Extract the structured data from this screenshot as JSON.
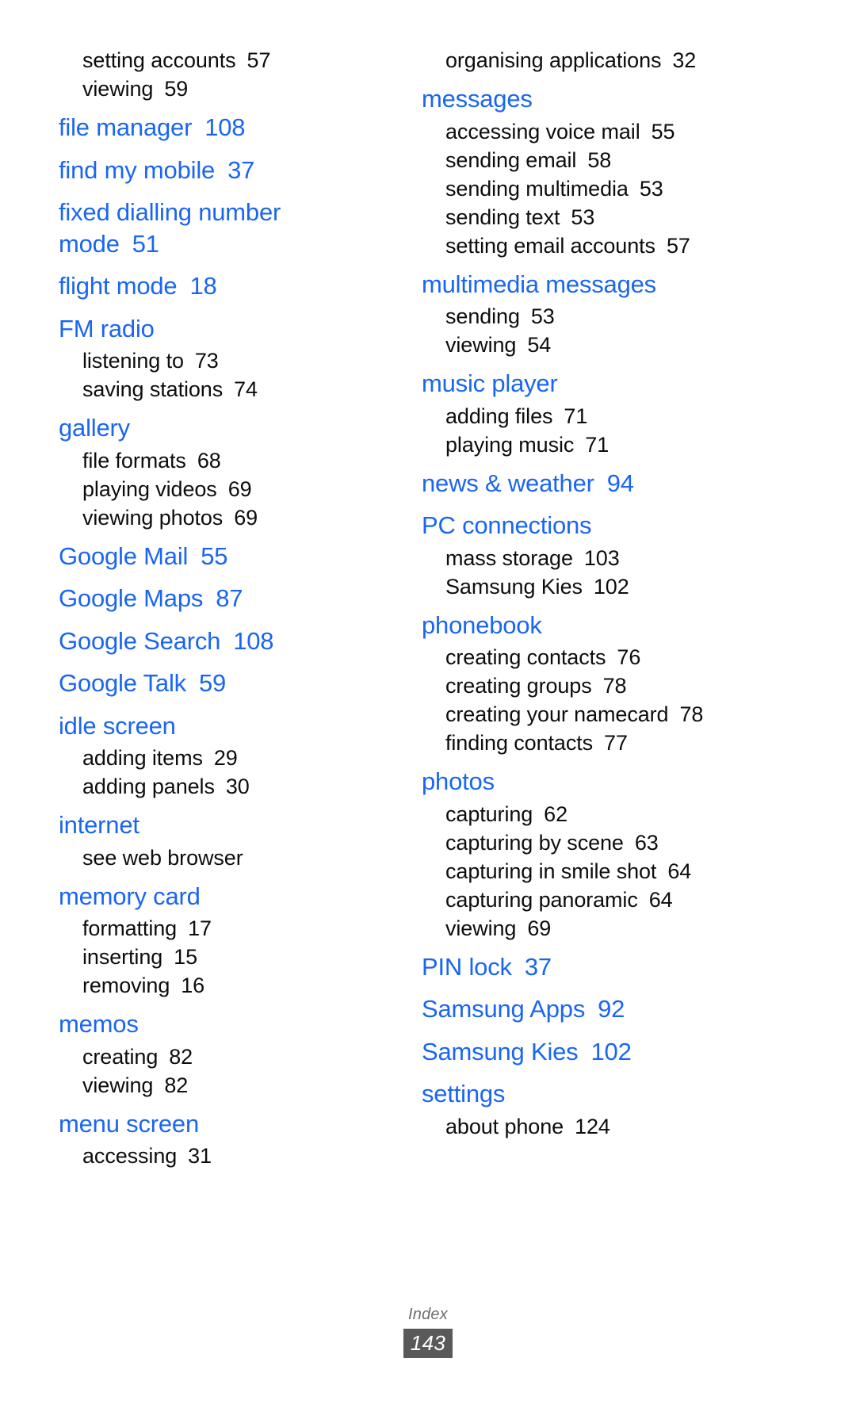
{
  "document": {
    "footer_label": "Index",
    "page_number": "143",
    "heading_color": "#1a66f0",
    "body_color": "#0d0d0d",
    "footer_label_color": "#6e6e6e",
    "footer_badge_color": "#595959"
  },
  "columns": [
    {
      "name": "left",
      "entries": [
        {
          "type": "sub",
          "label": "setting accounts",
          "num": "57"
        },
        {
          "type": "sub",
          "label": "viewing",
          "num": "59"
        },
        {
          "type": "head",
          "label": "file manager",
          "num": "108"
        },
        {
          "type": "head",
          "label": "find my mobile",
          "num": "37"
        },
        {
          "type": "head",
          "label": "fixed dialling number",
          "num": ""
        },
        {
          "type": "head-cont",
          "label": "mode",
          "num": "51"
        },
        {
          "type": "head",
          "label": "flight mode",
          "num": "18"
        },
        {
          "type": "head",
          "label": "FM radio",
          "num": ""
        },
        {
          "type": "sub",
          "label": "listening to",
          "num": "73"
        },
        {
          "type": "sub",
          "label": "saving stations",
          "num": "74"
        },
        {
          "type": "head",
          "label": "gallery",
          "num": ""
        },
        {
          "type": "sub",
          "label": "file formats",
          "num": "68"
        },
        {
          "type": "sub",
          "label": "playing videos",
          "num": "69"
        },
        {
          "type": "sub",
          "label": "viewing photos",
          "num": "69"
        },
        {
          "type": "head",
          "label": "Google Mail",
          "num": "55"
        },
        {
          "type": "head",
          "label": "Google Maps",
          "num": "87"
        },
        {
          "type": "head",
          "label": "Google Search",
          "num": "108"
        },
        {
          "type": "head",
          "label": "Google Talk",
          "num": "59"
        },
        {
          "type": "head",
          "label": "idle screen",
          "num": ""
        },
        {
          "type": "sub",
          "label": "adding items",
          "num": "29"
        },
        {
          "type": "sub",
          "label": "adding panels",
          "num": "30"
        },
        {
          "type": "head",
          "label": "internet",
          "num": ""
        },
        {
          "type": "sub",
          "label": "see web browser",
          "num": ""
        },
        {
          "type": "head",
          "label": "memory card",
          "num": ""
        },
        {
          "type": "sub",
          "label": "formatting",
          "num": "17"
        },
        {
          "type": "sub",
          "label": "inserting",
          "num": "15"
        },
        {
          "type": "sub",
          "label": "removing",
          "num": "16"
        },
        {
          "type": "head",
          "label": "memos",
          "num": ""
        },
        {
          "type": "sub",
          "label": "creating",
          "num": "82"
        },
        {
          "type": "sub",
          "label": "viewing",
          "num": "82"
        },
        {
          "type": "head",
          "label": "menu screen",
          "num": ""
        },
        {
          "type": "sub",
          "label": "accessing",
          "num": "31"
        }
      ]
    },
    {
      "name": "right",
      "entries": [
        {
          "type": "sub",
          "label": "organising applications",
          "num": "32"
        },
        {
          "type": "head",
          "label": "messages",
          "num": ""
        },
        {
          "type": "sub",
          "label": "accessing voice mail",
          "num": "55"
        },
        {
          "type": "sub",
          "label": "sending email",
          "num": "58"
        },
        {
          "type": "sub",
          "label": "sending multimedia",
          "num": "53"
        },
        {
          "type": "sub",
          "label": "sending text",
          "num": "53"
        },
        {
          "type": "sub",
          "label": "setting email accounts",
          "num": "57"
        },
        {
          "type": "head",
          "label": "multimedia messages",
          "num": ""
        },
        {
          "type": "sub",
          "label": "sending",
          "num": "53"
        },
        {
          "type": "sub",
          "label": "viewing",
          "num": "54"
        },
        {
          "type": "head",
          "label": "music player",
          "num": ""
        },
        {
          "type": "sub",
          "label": "adding files",
          "num": "71"
        },
        {
          "type": "sub",
          "label": "playing music",
          "num": "71"
        },
        {
          "type": "head",
          "label": "news & weather",
          "num": "94"
        },
        {
          "type": "head",
          "label": "PC connections",
          "num": ""
        },
        {
          "type": "sub",
          "label": "mass storage",
          "num": "103"
        },
        {
          "type": "sub",
          "label": "Samsung Kies",
          "num": "102"
        },
        {
          "type": "head",
          "label": "phonebook",
          "num": ""
        },
        {
          "type": "sub",
          "label": "creating contacts",
          "num": "76"
        },
        {
          "type": "sub",
          "label": "creating groups",
          "num": "78"
        },
        {
          "type": "sub",
          "label": "creating your namecard",
          "num": "78"
        },
        {
          "type": "sub",
          "label": "finding contacts",
          "num": "77"
        },
        {
          "type": "head",
          "label": "photos",
          "num": ""
        },
        {
          "type": "sub",
          "label": "capturing",
          "num": "62"
        },
        {
          "type": "sub",
          "label": "capturing by scene",
          "num": "63"
        },
        {
          "type": "sub",
          "label": "capturing in smile shot",
          "num": "64"
        },
        {
          "type": "sub",
          "label": "capturing panoramic",
          "num": "64"
        },
        {
          "type": "sub",
          "label": "viewing",
          "num": "69"
        },
        {
          "type": "head",
          "label": "PIN lock",
          "num": "37"
        },
        {
          "type": "head",
          "label": "Samsung Apps",
          "num": "92"
        },
        {
          "type": "head",
          "label": "Samsung Kies",
          "num": "102"
        },
        {
          "type": "head",
          "label": "settings",
          "num": ""
        },
        {
          "type": "sub",
          "label": "about phone",
          "num": "124"
        }
      ]
    }
  ]
}
